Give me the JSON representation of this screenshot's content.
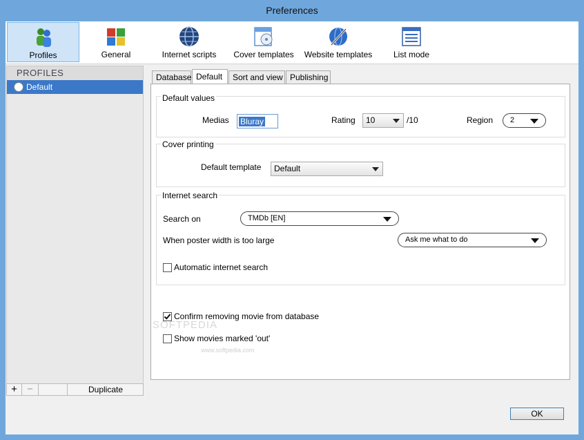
{
  "window": {
    "title": "Preferences"
  },
  "toolbar": {
    "items": [
      {
        "label": "Profiles",
        "icon": "users-icon"
      },
      {
        "label": "General",
        "icon": "cubes-icon"
      },
      {
        "label": "Internet scripts",
        "icon": "globe-icon"
      },
      {
        "label": "Cover templates",
        "icon": "cover-template-icon"
      },
      {
        "label": "Website templates",
        "icon": "website-template-icon"
      },
      {
        "label": "List mode",
        "icon": "list-mode-icon"
      }
    ],
    "active": "Profiles"
  },
  "profiles": {
    "header": "PROFILES",
    "items": [
      "Default"
    ],
    "selected": "Default",
    "add_label": "+",
    "remove_label": "−",
    "duplicate_label": "Duplicate"
  },
  "tabs": {
    "items": [
      "Database",
      "Default",
      "Sort and view",
      "Publishing"
    ],
    "active": "Default"
  },
  "default_values": {
    "title": "Default values",
    "medias_label": "Medias",
    "medias_value": "Bluray",
    "rating_label": "Rating",
    "rating_value": "10",
    "rating_suffix": "/10",
    "region_label": "Region",
    "region_value": "2"
  },
  "cover_printing": {
    "title": "Cover printing",
    "template_label": "Default template",
    "template_value": "Default"
  },
  "internet_search": {
    "title": "Internet search",
    "search_on_label": "Search on",
    "search_on_value": "TMDb [EN]",
    "poster_label": "When poster width is too large",
    "poster_value": "Ask me what to do",
    "auto_search_label": "Automatic internet search",
    "auto_search_checked": false
  },
  "options": {
    "confirm_remove_label": "Confirm removing movie from database",
    "confirm_remove_checked": true,
    "show_out_label": "Show movies marked 'out'",
    "show_out_checked": false
  },
  "watermark": {
    "text": "SOFTPEDIA",
    "url": "www.softpedia.com"
  },
  "footer": {
    "ok_label": "OK"
  }
}
